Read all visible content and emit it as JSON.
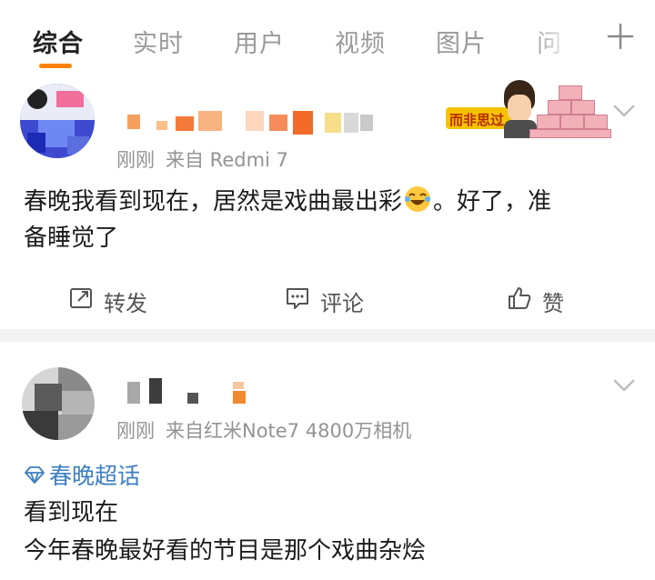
{
  "tabs": [
    "综合",
    "实时",
    "用户",
    "视频",
    "图片",
    "问"
  ],
  "posts": [
    {
      "time": "刚刚",
      "source": "来自 Redmi 7",
      "text_line1": "春晚我看到现在，居然是戏曲最出彩",
      "text_tail1": "。好了，准",
      "text_line2": "备睡觉了",
      "sticker_text": "而非思过",
      "actions": {
        "repost": "转发",
        "comment": "评论",
        "like": "赞"
      }
    },
    {
      "time": "刚刚",
      "source": "来自红米Note7 4800万相机",
      "topic": "春晚超话",
      "text_line1": "看到现在",
      "text_line2": "今年春晚最好看的节目是那个戏曲杂烩"
    }
  ],
  "colors": {
    "accent": "#ff8200",
    "link": "#3e7fc1",
    "meta": "#939393",
    "divider": "#f2f2f2"
  },
  "icons": [
    "plus-icon",
    "chevron-down-icon",
    "laugh-emoji-icon",
    "repost-icon",
    "comment-icon",
    "like-icon",
    "topic-diamond-icon"
  ]
}
